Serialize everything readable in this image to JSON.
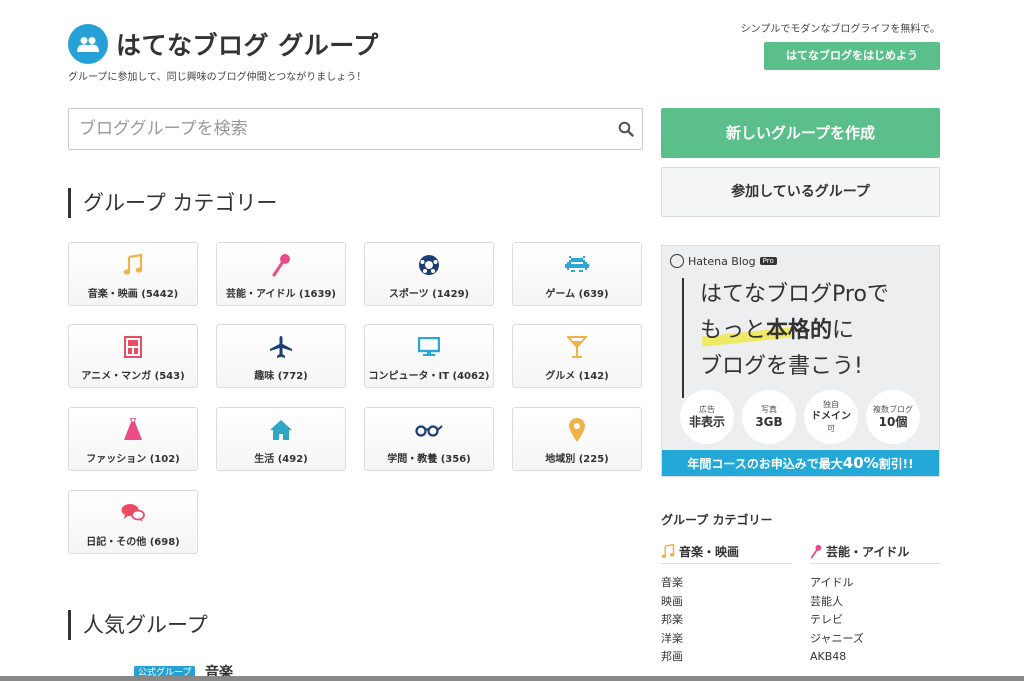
{
  "header": {
    "title": "はてなブログ グループ",
    "tagline": "グループに参加して、同じ興味のブログ仲間とつながりましょう！",
    "promo_text": "シンプルでモダンなブログライフを無料で。",
    "start_button": "はてなブログをはじめよう"
  },
  "search": {
    "placeholder": "ブロググループを検索"
  },
  "buttons": {
    "create": "新しいグループを作成",
    "joined": "参加しているグループ"
  },
  "categories_title": "グループ カテゴリー",
  "categories": [
    {
      "label": "音楽・映画 (5442)",
      "icon": "music-note-icon",
      "color": "#f0b34a"
    },
    {
      "label": "芸能・アイドル (1639)",
      "icon": "microphone-icon",
      "color": "#e94c89"
    },
    {
      "label": "スポーツ (1429)",
      "icon": "soccer-ball-icon",
      "color": "#1d3e72"
    },
    {
      "label": "ゲーム (639)",
      "icon": "space-invader-icon",
      "color": "#29a8d5"
    },
    {
      "label": "アニメ・マンガ (543)",
      "icon": "manga-book-icon",
      "color": "#e94c63"
    },
    {
      "label": "趣味 (772)",
      "icon": "airplane-icon",
      "color": "#1d3e72"
    },
    {
      "label": "コンピュータ・IT (4062)",
      "icon": "monitor-icon",
      "color": "#29a8d5"
    },
    {
      "label": "グルメ (142)",
      "icon": "cocktail-icon",
      "color": "#f0b34a"
    },
    {
      "label": "ファッション (102)",
      "icon": "dress-icon",
      "color": "#e94c89"
    },
    {
      "label": "生活 (492)",
      "icon": "house-icon",
      "color": "#2ea7c5"
    },
    {
      "label": "学問・教養 (356)",
      "icon": "glasses-icon",
      "color": "#1d3e72"
    },
    {
      "label": "地域別 (225)",
      "icon": "map-pin-icon",
      "color": "#f0b34a"
    },
    {
      "label": "日記・その他 (698)",
      "icon": "speech-bubbles-icon",
      "color": "#e94c63"
    }
  ],
  "popular_title": "人気グループ",
  "popular_peek": {
    "badge": "公式グループ",
    "name": "音楽"
  },
  "ad": {
    "brand": "Hatena Blog",
    "brand_badge": "Pro",
    "line1": "はてなブログProで",
    "line2_a": "もっと",
    "line2_b": "本格的",
    "line2_c": "に",
    "line3": "ブログを書こう!",
    "features": [
      {
        "small": "広告",
        "large": "非表示"
      },
      {
        "small": "写真",
        "large": "3GB"
      },
      {
        "small": "独自",
        "large": "ドメイン",
        "extra": "可"
      },
      {
        "small": "複数ブログ",
        "large": "10個"
      }
    ],
    "banner_a": "年間コースのお申込みで最大",
    "banner_b": "40%",
    "banner_c": "割引!!"
  },
  "sidebar": {
    "title": "グループ カテゴリー",
    "columns": [
      {
        "heading": "音楽・映画",
        "icon": "music-note-icon",
        "items": [
          "音楽",
          "映画",
          "邦楽",
          "洋楽",
          "邦画"
        ]
      },
      {
        "heading": "芸能・アイドル",
        "icon": "microphone-icon",
        "items": [
          "アイドル",
          "芸能人",
          "テレビ",
          "ジャニーズ",
          "AKB48"
        ]
      }
    ]
  }
}
